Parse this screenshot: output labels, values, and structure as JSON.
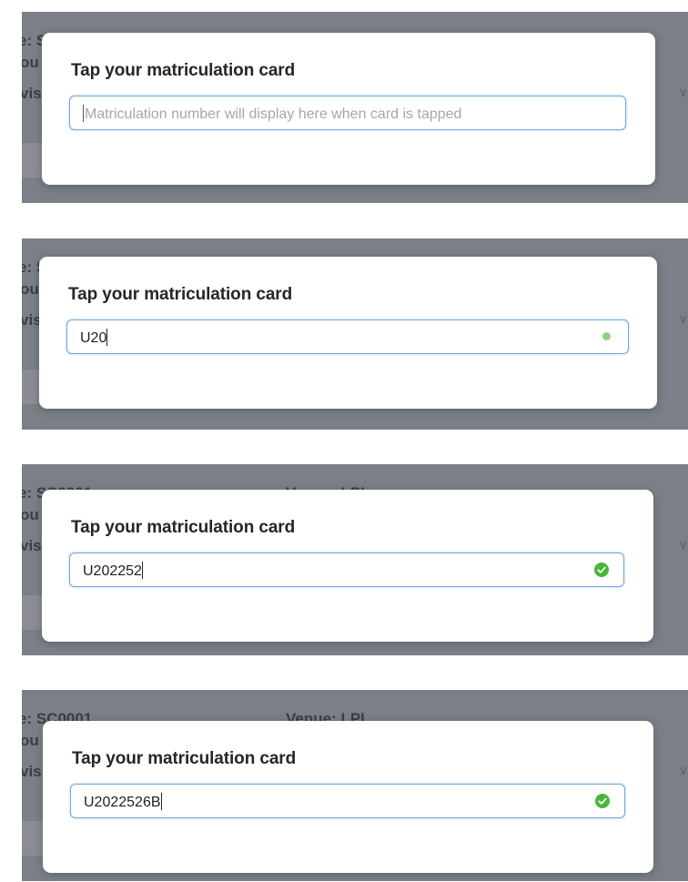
{
  "background": {
    "session_label": "e: SC0001",
    "venue_label": "Venue: LPI",
    "row2_fragment": "ou",
    "row3_fragment": "vis",
    "chevron_glyph": "∨"
  },
  "colors": {
    "overlay": "#7b8088",
    "input_border": "#6fa8e0",
    "success": "#46b839"
  },
  "panels": [
    {
      "title": "Tap your matriculation card",
      "input_value": "",
      "input_placeholder": "Matriculation number will display here when card is tapped",
      "status_icon": "none"
    },
    {
      "title": "Tap your matriculation card",
      "input_value": "U20",
      "input_placeholder": "",
      "status_icon": "check-circle-small-icon"
    },
    {
      "title": "Tap your matriculation card",
      "input_value": "U202252",
      "input_placeholder": "",
      "status_icon": "check-circle-icon"
    },
    {
      "title": "Tap your matriculation card",
      "input_value": "U2022526B",
      "input_placeholder": "",
      "status_icon": "check-circle-icon"
    }
  ]
}
